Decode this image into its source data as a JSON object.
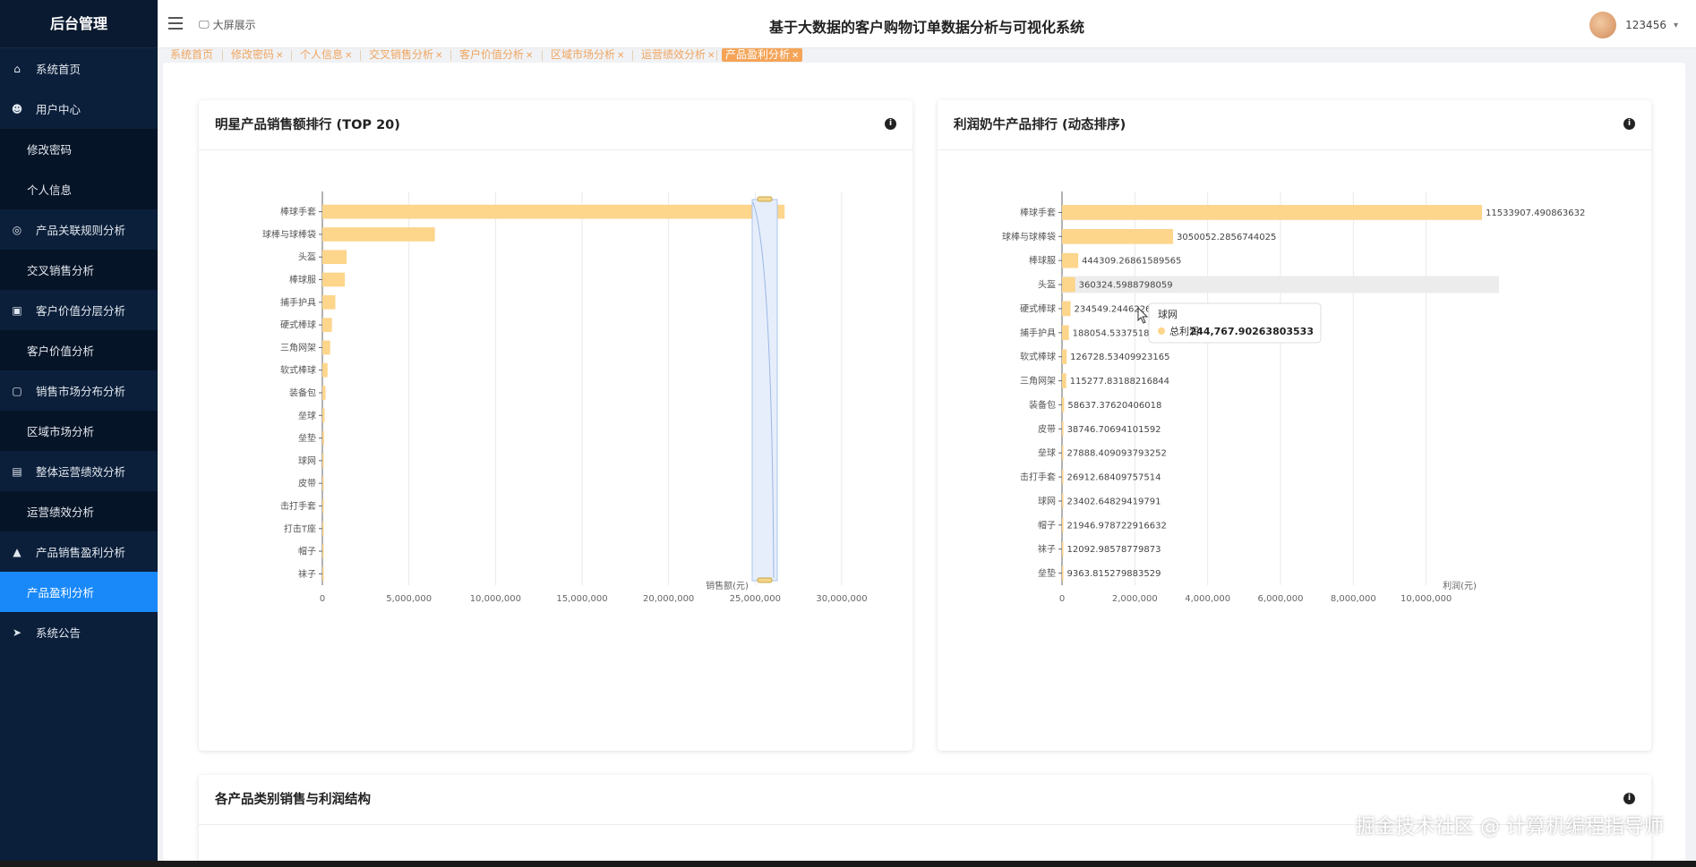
{
  "sidebar": {
    "logo": "后台管理",
    "items": [
      {
        "label": "系统首页",
        "type": "top",
        "icon": "home-icon"
      },
      {
        "label": "用户中心",
        "type": "top",
        "icon": "user-icon"
      },
      {
        "label": "修改密码",
        "type": "sub"
      },
      {
        "label": "个人信息",
        "type": "sub"
      },
      {
        "label": "产品关联规则分析",
        "type": "top",
        "icon": "target-icon"
      },
      {
        "label": "交叉销售分析",
        "type": "sub"
      },
      {
        "label": "客户价值分层分析",
        "type": "top",
        "icon": "briefcase-icon"
      },
      {
        "label": "客户价值分析",
        "type": "sub"
      },
      {
        "label": "销售市场分布分析",
        "type": "top",
        "icon": "chat-icon"
      },
      {
        "label": "区域市场分析",
        "type": "sub"
      },
      {
        "label": "整体运营绩效分析",
        "type": "top",
        "icon": "clipboard-icon"
      },
      {
        "label": "运营绩效分析",
        "type": "sub"
      },
      {
        "label": "产品销售盈利分析",
        "type": "top",
        "icon": "thumbs-up-icon"
      },
      {
        "label": "产品盈利分析",
        "type": "sub",
        "active": true
      },
      {
        "label": "系统公告",
        "type": "top",
        "icon": "send-icon"
      }
    ]
  },
  "topbar": {
    "screen_label": "大屏展示",
    "title": "基于大数据的客户购物订单数据分析与可视化系统",
    "username": "123456"
  },
  "tags": [
    {
      "label": "系统首页",
      "closable": false
    },
    {
      "label": "修改密码",
      "closable": true
    },
    {
      "label": "个人信息",
      "closable": true
    },
    {
      "label": "交叉销售分析",
      "closable": true
    },
    {
      "label": "客户价值分析",
      "closable": true
    },
    {
      "label": "区域市场分析",
      "closable": true
    },
    {
      "label": "运营绩效分析",
      "closable": true
    },
    {
      "label": "产品盈利分析",
      "closable": true,
      "active": true
    }
  ],
  "cards": {
    "sales_title": "明星产品销售额排行 (TOP 20)",
    "profit_title": "利润奶牛产品排行 (动态排序)",
    "structure_title": "各产品类别销售与利润结构"
  },
  "watermark": "掘金技术社区 @ 计算机编程指导师",
  "colors": {
    "bar": "#fdd58b",
    "accent": "#1989fa",
    "sidebar": "#0b1f3a",
    "tag": "#f5a458"
  },
  "chart_data": [
    {
      "type": "bar",
      "orientation": "horizontal",
      "title": "明星产品销售额排行 (TOP 20)",
      "xlabel": "销售额(元)",
      "categories": [
        "棒球手套",
        "球棒与球棒袋",
        "头盔",
        "棒球服",
        "捕手护具",
        "硬式棒球",
        "三角网架",
        "软式棒球",
        "装备包",
        "垒球",
        "垒垫",
        "球网",
        "皮带",
        "击打手套",
        "打击T座",
        "帽子",
        "袜子"
      ],
      "values": [
        26700000,
        6500000,
        1400000,
        1300000,
        750000,
        550000,
        450000,
        300000,
        180000,
        130000,
        100000,
        80000,
        60000,
        50000,
        40000,
        30000,
        20000
      ],
      "xlim": [
        0,
        30000000
      ],
      "xticks": [
        "0",
        "5,000,000",
        "10,000,000",
        "15,000,000",
        "20,000,000",
        "25,000,000",
        "30,000,000"
      ],
      "grid": true
    },
    {
      "type": "bar",
      "orientation": "horizontal",
      "title": "利润奶牛产品排行 (动态排序)",
      "xlabel": "利润(元)",
      "categories": [
        "棒球手套",
        "球棒与球棒袋",
        "棒球服",
        "头盔",
        "硬式棒球",
        "捕手护具",
        "软式棒球",
        "三角网架",
        "装备包",
        "皮带",
        "垒球",
        "击打手套",
        "球网",
        "帽子",
        "袜子",
        "垒垫"
      ],
      "values": [
        11533907.490863632,
        3050052.2856744025,
        444309.26861589565,
        360324.5988798059,
        234549.24462262,
        188054.5337518138,
        126728.53409923165,
        115277.83188216844,
        58637.37620406018,
        38746.70694101592,
        27888.409093793252,
        26912.68409757514,
        23402.64829419791,
        21946.978722916632,
        12092.98578779873,
        9363.815279883529
      ],
      "data_labels": [
        "11533907.490863632",
        "3050052.2856744025",
        "444309.26861589565",
        "360324.5988798059",
        "234549.24462262",
        "188054.5337518138",
        "126728.53409923165",
        "115277.83188216844",
        "58637.37620406018",
        "38746.70694101592",
        "27888.409093793252",
        "26912.68409757514",
        "23402.64829419791",
        "21946.978722916632",
        "12092.98578779873",
        "9363.815279883529"
      ],
      "xlim": [
        0,
        12000000
      ],
      "xticks": [
        "0",
        "2,000,000",
        "4,000,000",
        "6,000,000",
        "8,000,000",
        "10,000,000"
      ],
      "grid": true,
      "tooltip": {
        "title": "球网",
        "series": "总利润",
        "value": "244,767.90263803533"
      }
    }
  ]
}
